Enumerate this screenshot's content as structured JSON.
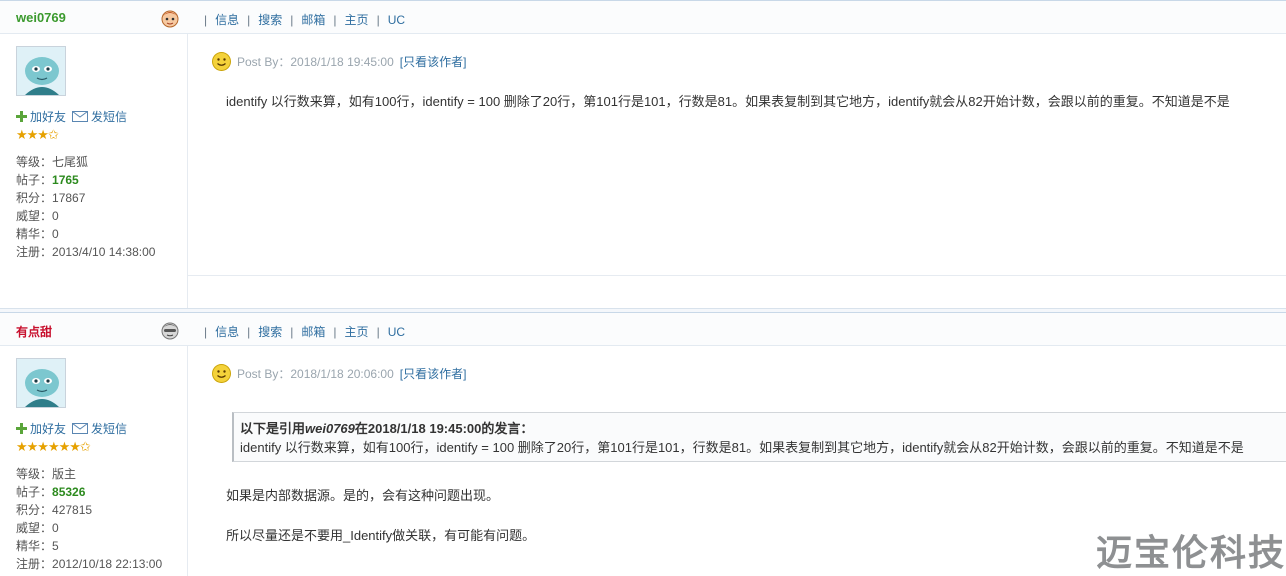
{
  "nav": {
    "sep": "|",
    "items": [
      "信息",
      "搜索",
      "邮箱",
      "主页",
      "UC"
    ]
  },
  "actions": {
    "add_friend": "加好友",
    "send_msg": "发短信"
  },
  "posts": [
    {
      "username": "wei0769",
      "stars": "★★★✩",
      "stats": {
        "level_label": "等级：",
        "level": "七尾狐",
        "posts_label": "帖子：",
        "posts": "1765",
        "points_label": "积分：",
        "points": "17867",
        "prestige_label": "威望：",
        "prestige": "0",
        "essence_label": "精华：",
        "essence": "0",
        "reg_label": "注册：",
        "reg": "2013/4/10 14:38:00"
      },
      "post_by": "Post By：2018/1/18 19:45:00",
      "author_link": "[只看该作者]",
      "content": "identify 以行数来算，如有100行，identify = 100 删除了20行，第101行是101，行数是81。如果表复制到其它地方，identify就会从82开始计数，会跟以前的重复。不知道是不是"
    },
    {
      "username": "有点甜",
      "stars": "★★★★★★✩",
      "stats": {
        "level_label": "等级：",
        "level": "版主",
        "posts_label": "帖子：",
        "posts": "85326",
        "points_label": "积分：",
        "points": "427815",
        "prestige_label": "威望：",
        "prestige": "0",
        "essence_label": "精华：",
        "essence": "5",
        "reg_label": "注册：",
        "reg": "2012/10/18 22:13:00"
      },
      "post_by": "Post By：2018/1/18 20:06:00",
      "author_link": "[只看该作者]",
      "quote_head_pre": "以下是引用",
      "quote_user": "wei0769",
      "quote_head_post": "在2018/1/18 19:45:00的发言：",
      "quote_text": "identify 以行数来算，如有100行，identify = 100 删除了20行，第101行是101，行数是81。如果表复制到其它地方，identify就会从82开始计数，会跟以前的重复。不知道是不是",
      "content_line1": "如果是内部数据源。是的，会有这种问题出现。",
      "content_line2": "所以尽量还是不要用_Identify做关联，有可能有问题。"
    }
  ],
  "watermark": "迈宝伦科技"
}
